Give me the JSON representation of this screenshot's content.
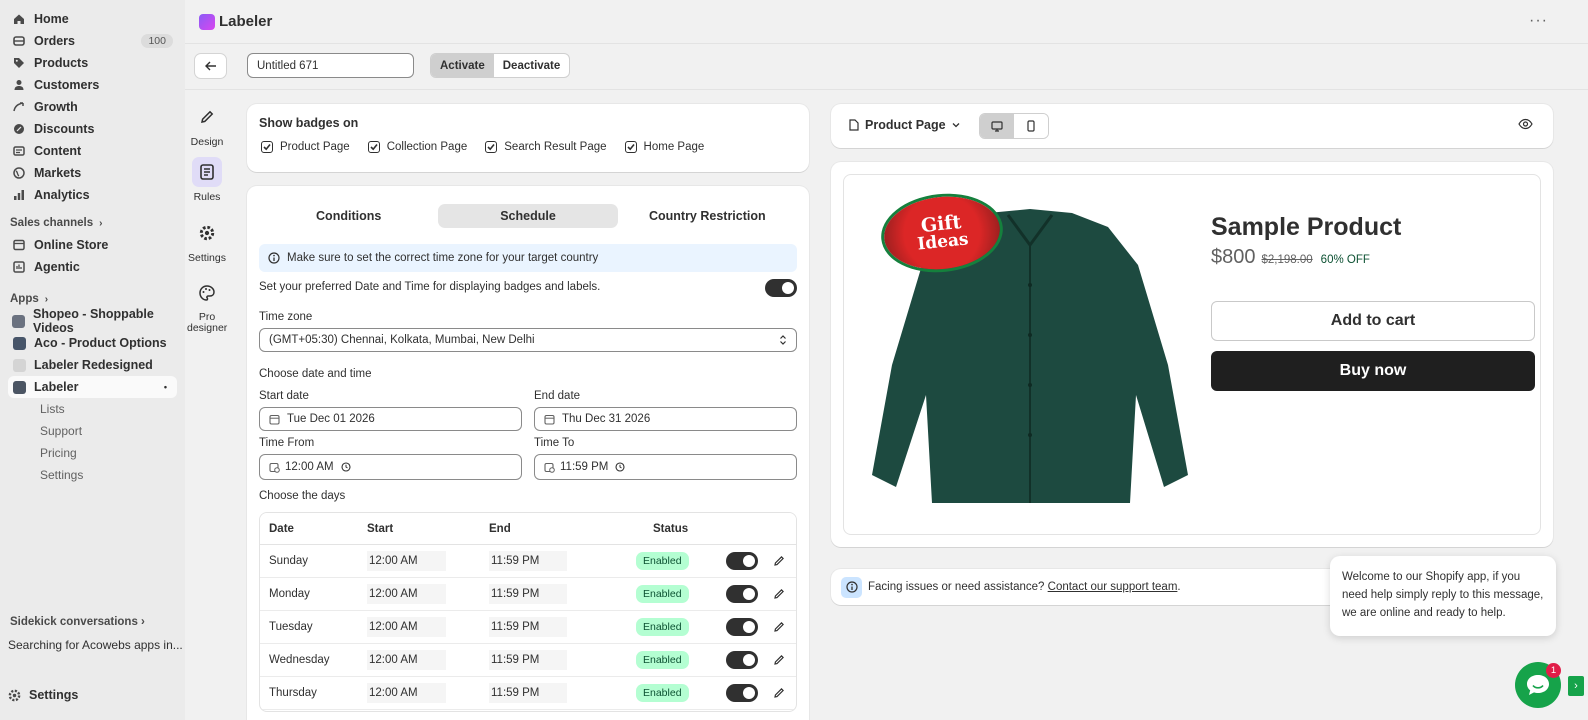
{
  "sidebar": {
    "nav": [
      {
        "label": "Home",
        "icon": "home-icon"
      },
      {
        "label": "Orders",
        "icon": "orders-icon",
        "badge": "100"
      },
      {
        "label": "Products",
        "icon": "tag-icon"
      },
      {
        "label": "Customers",
        "icon": "person-icon"
      },
      {
        "label": "Growth",
        "icon": "growth-icon"
      },
      {
        "label": "Discounts",
        "icon": "discount-icon"
      },
      {
        "label": "Content",
        "icon": "content-icon"
      },
      {
        "label": "Markets",
        "icon": "globe-icon"
      },
      {
        "label": "Analytics",
        "icon": "analytics-icon"
      }
    ],
    "sales_channels_label": "Sales channels",
    "channels": [
      {
        "label": "Online Store"
      },
      {
        "label": "Agentic"
      }
    ],
    "apps_label": "Apps",
    "apps": [
      {
        "label": "Shopeo - Shoppable Videos"
      },
      {
        "label": "Aco - Product Options"
      },
      {
        "label": "Labeler Redesigned"
      },
      {
        "label": "Labeler"
      }
    ],
    "labeler_sub": [
      "Lists",
      "Support",
      "Pricing",
      "Settings"
    ],
    "sidekick_label": "Sidekick conversations",
    "sidekick_item": "Searching for Acowebs apps in...",
    "settings_label": "Settings"
  },
  "header": {
    "title": "Labeler",
    "more_icon": "more-horizontal-icon"
  },
  "toolbar": {
    "name_value": "Untitled 671",
    "activate_label": "Activate",
    "deactivate_label": "Deactivate"
  },
  "rail": [
    {
      "label": "Design",
      "icon": "pencil-icon"
    },
    {
      "label": "Rules",
      "icon": "rules-icon"
    },
    {
      "label": "Settings",
      "icon": "gear-icon"
    },
    {
      "label": "Pro designer",
      "icon": "palette-icon"
    }
  ],
  "badges_card": {
    "title": "Show badges on",
    "options": [
      "Product Page",
      "Collection Page",
      "Search Result Page",
      "Home Page"
    ]
  },
  "schedule": {
    "tabs": [
      "Conditions",
      "Schedule",
      "Country Restriction"
    ],
    "info": "Make sure to set the correct time zone for your target country",
    "toggle_label": "Set your preferred Date and Time for displaying badges and labels.",
    "timezone_label": "Time zone",
    "timezone_value": "(GMT+05:30) Chennai, Kolkata, Mumbai, New Delhi",
    "choose_label": "Choose date and time",
    "start_date_label": "Start date",
    "start_date_value": "Tue Dec 01 2026",
    "end_date_label": "End date",
    "end_date_value": "Thu Dec 31 2026",
    "time_from_label": "Time From",
    "time_from_value": "12:00 AM",
    "time_to_label": "Time To",
    "time_to_value": "11:59 PM",
    "days_label": "Choose the days",
    "columns": [
      "Date",
      "Start",
      "End",
      "Status"
    ],
    "rows": [
      {
        "day": "Sunday",
        "start": "12:00  AM",
        "end": "11:59  PM",
        "status": "Enabled"
      },
      {
        "day": "Monday",
        "start": "12:00  AM",
        "end": "11:59  PM",
        "status": "Enabled"
      },
      {
        "day": "Tuesday",
        "start": "12:00  AM",
        "end": "11:59  PM",
        "status": "Enabled"
      },
      {
        "day": "Wednesday",
        "start": "12:00  AM",
        "end": "11:59  PM",
        "status": "Enabled"
      },
      {
        "day": "Thursday",
        "start": "12:00  AM",
        "end": "11:59  PM",
        "status": "Enabled"
      }
    ]
  },
  "preview": {
    "page_select": "Product Page",
    "badge_text_1": "Gift",
    "badge_text_2": "Ideas",
    "product_title": "Sample Product",
    "price": "$800",
    "compare_price": "$2,198.00",
    "discount": "60% OFF",
    "add_to_cart": "Add to cart",
    "buy_now": "Buy now",
    "help_text": "Facing issues or need assistance?",
    "help_link": "Contact our support team",
    "help_period": "."
  },
  "chat": {
    "message": "Welcome to our Shopify app, if you need help simply reply to this message, we are online and ready to help.",
    "unread": "1"
  },
  "colors": {
    "accent_purple": "#8b5cf6",
    "enabled_bg": "#b4fed2",
    "chat_green": "#16a34a",
    "shirt": "#1d4a40"
  }
}
